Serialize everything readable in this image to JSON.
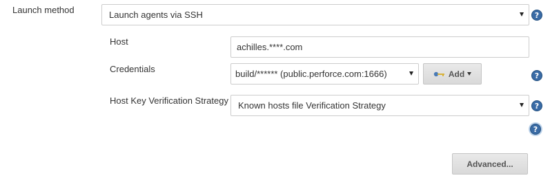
{
  "launch_method": {
    "label": "Launch method",
    "selected": "Launch agents via SSH"
  },
  "host": {
    "label": "Host",
    "value": "achilles.****.com"
  },
  "credentials": {
    "label": "Credentials",
    "selected": "build/****** (public.perforce.com:1666)",
    "add_label": "Add"
  },
  "host_key": {
    "label": "Host Key Verification Strategy",
    "selected": "Known hosts file Verification Strategy"
  },
  "advanced_label": "Advanced...",
  "icons": {
    "help": "help-icon",
    "key": "key-icon",
    "caret": "caret-down-icon"
  },
  "colors": {
    "help_blue": "#3a6ba5",
    "button_bg": "#dcdcdc"
  }
}
